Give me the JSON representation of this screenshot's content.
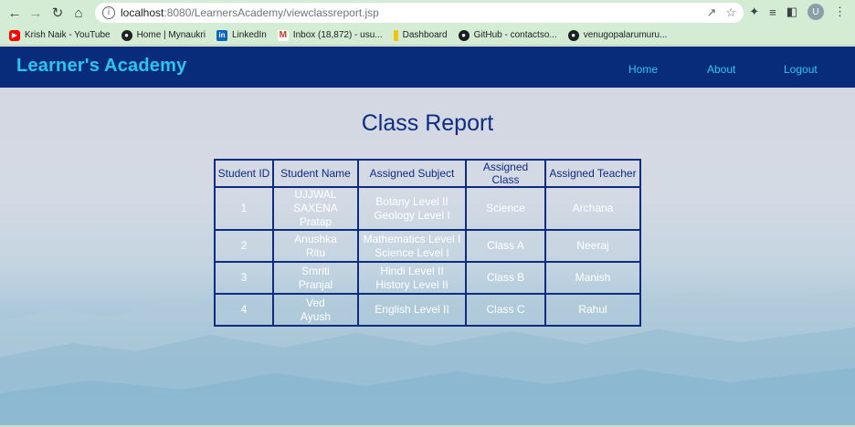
{
  "browser": {
    "url_host": "localhost",
    "url_path": ":8080/LearnersAcademy/viewclassreport.jsp",
    "profile_initial": "U",
    "bookmarks": [
      {
        "label": "Krish Naik - YouTube",
        "icon": "youtube-icon"
      },
      {
        "label": "Home | Mynaukri",
        "icon": "globe-icon"
      },
      {
        "label": "LinkedIn",
        "icon": "linkedin-icon"
      },
      {
        "label": "Inbox (18,872) - usu...",
        "icon": "gmail-icon"
      },
      {
        "label": "Dashboard",
        "icon": "dashboard-icon"
      },
      {
        "label": "GitHub - contactso...",
        "icon": "github-icon"
      },
      {
        "label": "venugopalarumuru...",
        "icon": "github-icon"
      }
    ]
  },
  "header": {
    "brand": "Learner's Academy",
    "nav": {
      "home": "Home",
      "about": "About",
      "logout": "Logout"
    }
  },
  "page_title": "Class Report",
  "table": {
    "headers": [
      "Student ID",
      "Student Name",
      "Assigned Subject",
      "Assigned Class",
      "Assigned Teacher"
    ],
    "rows": [
      {
        "id": "1",
        "names": [
          "UJJWAL SAXENA",
          "Pratap"
        ],
        "subjects": [
          "Botany Level II",
          "Geology Level I"
        ],
        "class": "Science",
        "teacher": "Archana"
      },
      {
        "id": "2",
        "names": [
          "Anushka",
          "Ritu"
        ],
        "subjects": [
          "Mathematics Level I",
          "Science Level I"
        ],
        "class": "Class A",
        "teacher": "Neeraj"
      },
      {
        "id": "3",
        "names": [
          "Smriti",
          "Pranjal"
        ],
        "subjects": [
          "Hindi Level II",
          "History Level II"
        ],
        "class": "Class B",
        "teacher": "Manish"
      },
      {
        "id": "4",
        "names": [
          "Ved",
          "Ayush"
        ],
        "subjects": [
          "English Level II"
        ],
        "class": "Class C",
        "teacher": "Rahul"
      }
    ]
  },
  "colors": {
    "header_bg": "#082b7a",
    "accent": "#27c8f0",
    "table_border": "#0d2c82"
  }
}
